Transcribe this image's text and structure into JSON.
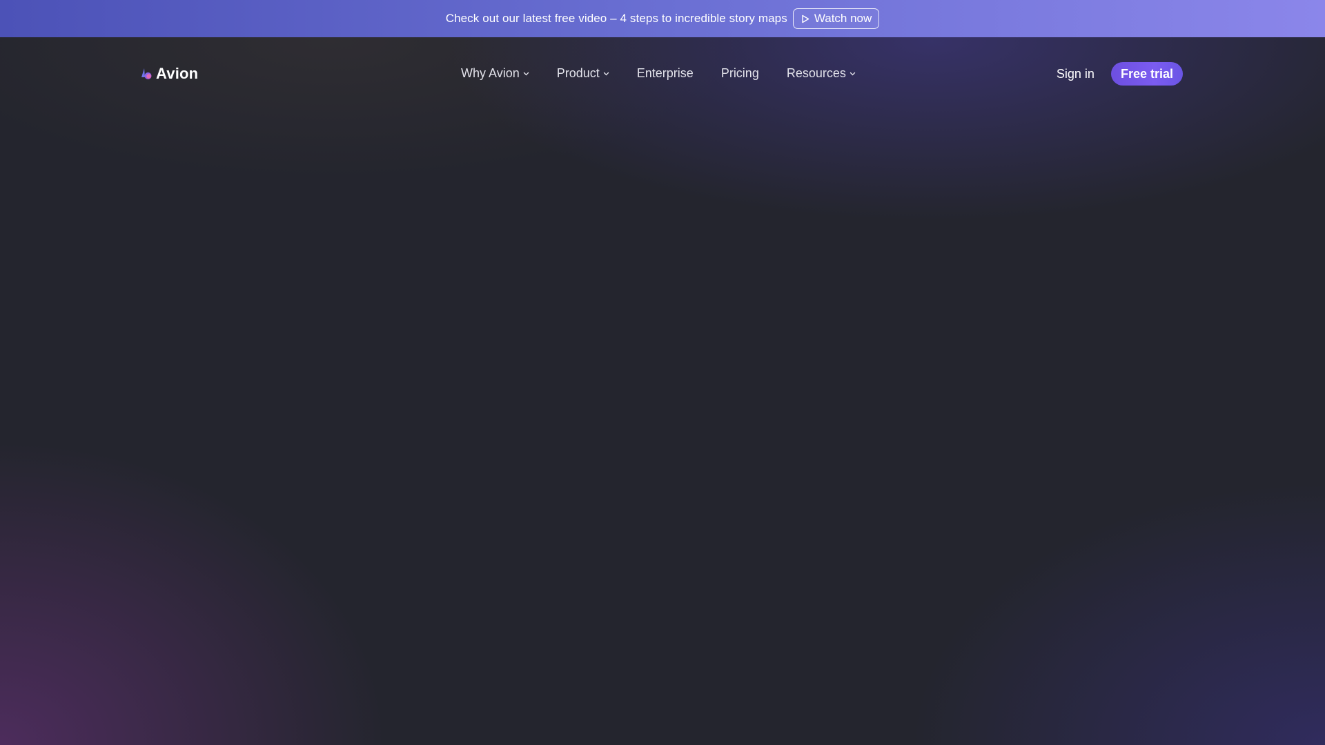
{
  "banner": {
    "text": "Check out our latest free video – 4 steps to incredible story maps",
    "watch_label": "Watch now",
    "watch_icon": "play-icon"
  },
  "header": {
    "logo_text": "Avion",
    "logo_icon": "avion-logo-icon",
    "nav": [
      {
        "label": "Why Avion",
        "has_dropdown": true
      },
      {
        "label": "Product",
        "has_dropdown": true
      },
      {
        "label": "Enterprise",
        "has_dropdown": false
      },
      {
        "label": "Pricing",
        "has_dropdown": false
      },
      {
        "label": "Resources",
        "has_dropdown": true
      }
    ],
    "sign_in_label": "Sign in",
    "free_trial_label": "Free trial"
  },
  "colors": {
    "banner_start": "#4c52b7",
    "banner_end": "#8b86ea",
    "accent": "#7b5cf0",
    "background": "#24252e"
  }
}
